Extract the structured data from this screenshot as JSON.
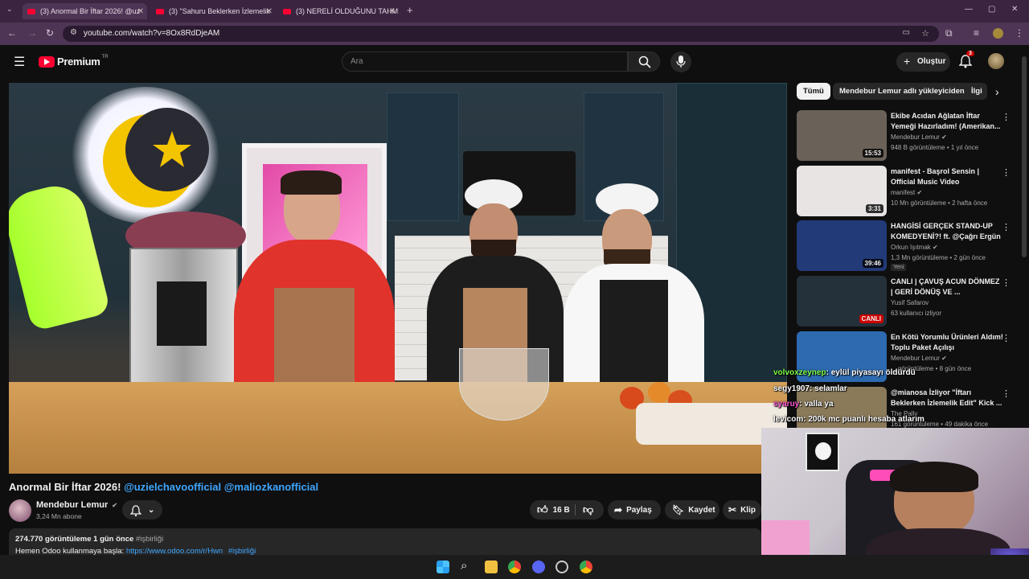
{
  "browser": {
    "tabs": [
      {
        "label": "(3) Anormal Bir İftar 2026! @uz"
      },
      {
        "label": "(3) \"Sahuru Beklerken İzlemelik"
      },
      {
        "label": "(3) NERELİ OLDUĞUNU TAHMİN"
      }
    ],
    "new_tab_glyph": "+",
    "url": "youtube.com/watch?v=8Ox8RdDjeAM"
  },
  "youtube": {
    "logo_text": "Premium",
    "logo_sup": "TR",
    "search_placeholder": "Ara",
    "create_label": "Oluştur",
    "notification_count": "3"
  },
  "video": {
    "title_main": "Anormal Bir İftar 2026!",
    "title_tags": "@uzielchavoofficial @maliozkanofficial",
    "channel_name": "Mendebur Lemur",
    "subscribers": "3,24 Mn abone",
    "likes": "16 B",
    "share_label": "Paylaş",
    "save_label": "Kaydet",
    "clip_label": "Klip",
    "views_date": "274.770 görüntüleme  1 gün önce",
    "hashtag": "#işbirliği",
    "desc_prefix": "Hemen Odoo kullanmaya başla:",
    "desc_link": "https://www.odoo.com/r/Hwn",
    "desc_hashtag": "#işbirliği"
  },
  "sidebar": {
    "chips": [
      "Tümü",
      "Mendebur Lemur adlı yükleyiciden",
      "İlgi"
    ],
    "recommendations": [
      {
        "title": "Ekibe Acıdan Ağlatan İftar Yemeği Hazırladım! (Amerikan...",
        "channel": "Mendebur Lemur",
        "meta": "948 B görüntüleme • 1 yıl önce",
        "duration": "15:53",
        "thumb_color": "#6a6158",
        "verified": true
      },
      {
        "title": "manifest - Başrol Sensin | Official Music Video",
        "channel": "manifest",
        "meta": "10 Mn görüntüleme • 2 hafta önce",
        "duration": "3:31",
        "thumb_color": "#e8e4e4",
        "verified": true
      },
      {
        "title": "HANGİSİ GERÇEK STAND-UP KOMEDYENİ?! ft. @Çağrı Ergün",
        "channel": "Orkun Işıtmak",
        "meta": "1,3 Mn görüntüleme • 2 gün önce",
        "duration": "39:46",
        "badge": "Yeni",
        "thumb_color": "#223a78",
        "verified": true
      },
      {
        "title": "CANLI | ÇAVUŞ ACUN DÖNMEZ | GERİ DÖNÜŞ VE ...",
        "channel": "Yusif Safarov",
        "meta": "63 kullanıcı izliyor",
        "duration": "CANLI",
        "thumb_color": "#24303a",
        "verified": false
      },
      {
        "title": "En Kötü Yorumlu Ürünleri Aldım! Toplu Paket Açılışı",
        "channel": "Mendebur Lemur",
        "meta": "... görüntüleme • 8 gün önce",
        "duration": "",
        "thumb_color": "#2d6ab0",
        "verified": true
      },
      {
        "title": "@mianosa İzliyor \"İftarı Beklerken İzlemelik Edit\" Kick ...",
        "channel": "The Pally",
        "meta": "161 görüntüleme • 49 dakika önce",
        "duration": "",
        "thumb_color": "#8a7a5a",
        "verified": false
      }
    ]
  },
  "chat_overlay": [
    {
      "user": "volvoxzeynep",
      "text": ": eylül piyasayı öldürdü",
      "user_color": "#7dff4a"
    },
    {
      "user": "segy1907",
      "text": ": selamlar",
      "user_color": "#ffffff"
    },
    {
      "user": "syaruy",
      "text": ": valla ya",
      "user_color": "#ff5ad2"
    },
    {
      "user": "levicom",
      "text": ": 200k mc puanlı hesaba atlarım",
      "user_color": "#ffffff"
    }
  ],
  "colors": {
    "accent": "#ff0033",
    "link": "#3ea6ff",
    "background": "#0f0f0f",
    "tabbar": "#3a2440"
  }
}
